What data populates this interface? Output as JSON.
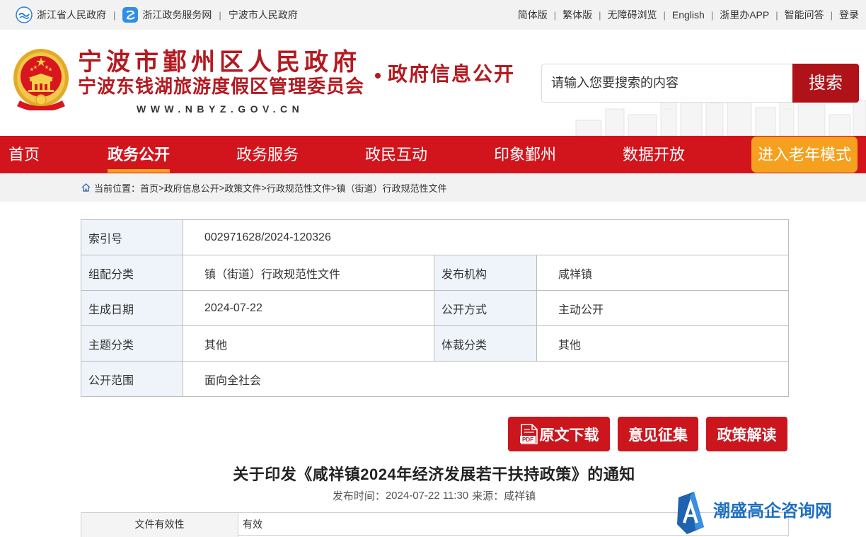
{
  "topbar": {
    "separator": "|",
    "left_links": [
      {
        "label": "浙江省人民政府",
        "icon": "zhejiang-province-gov-icon"
      },
      {
        "label": "浙江政务服务网",
        "icon": "zhejiang-gov-service-icon"
      },
      {
        "label": "宁波市人民政府"
      }
    ],
    "right_links": [
      "简体版",
      "繁体版",
      "无障碍浏览",
      "English",
      "浙里办APP",
      "智能问答",
      "登录"
    ]
  },
  "header": {
    "emblem_icon": "national-emblem-icon",
    "title_line1": "宁波市鄞州区人民政府",
    "title_line2": "宁波东钱湖旅游度假区管理委员会",
    "site_url": "WWW.NBYZ.GOV.CN",
    "section_title": "政府信息公开",
    "search": {
      "placeholder": "请输入您要搜索的内容",
      "button_label": "搜索"
    }
  },
  "nav": {
    "items": [
      "首页",
      "政务公开",
      "政务服务",
      "政民互动",
      "印象鄞州",
      "数据开放"
    ],
    "active_index": 1,
    "elder_mode_label": "进入老年模式"
  },
  "breadcrumb": {
    "home_icon": "home-icon",
    "prefix": "当前位置：",
    "separator": ">",
    "items": [
      "首页",
      "政府信息公开",
      "政策文件",
      "行政规范性文件",
      "镇（街道）行政规范性文件"
    ]
  },
  "meta_table": {
    "rows": [
      [
        {
          "label": "索引号",
          "value": "002971628/2024-120326"
        }
      ],
      [
        {
          "label": "组配分类",
          "value": "镇（街道）行政规范性文件"
        },
        {
          "label": "发布机构",
          "value": "咸祥镇"
        }
      ],
      [
        {
          "label": "生成日期",
          "value": "2024-07-22"
        },
        {
          "label": "公开方式",
          "value": "主动公开"
        }
      ],
      [
        {
          "label": "主题分类",
          "value": "其他"
        },
        {
          "label": "体裁分类",
          "value": "其他"
        }
      ],
      [
        {
          "label": "公开范围",
          "value": "面向全社会"
        }
      ]
    ]
  },
  "actions": {
    "download_icon": "pdf-icon",
    "pdf_icon_text": "PDF",
    "download_label": "原文下载",
    "comments_label": "意见征集",
    "interpretation_label": "政策解读"
  },
  "article": {
    "title": "关于印发《咸祥镇2024年经济发展若干扶持政策》的通知",
    "publish_time_label": "发布时间：",
    "publish_time": "2024-07-22 11:30",
    "source_label": "来源：",
    "source": "咸祥镇"
  },
  "validity_table": {
    "rows": [
      {
        "label": "文件有效性",
        "value": "有效"
      }
    ]
  },
  "watermark": {
    "logo_icon": "watermark-a-logo-icon",
    "text": "潮盛高企咨询网"
  },
  "colors": {
    "topbar_bg": "#f2f2f2",
    "brand_red": "#d2141c",
    "title_red": "#b31a20",
    "search_button": "#b0121a",
    "active_underline": "#f6a11d",
    "elder_mode_bg": "#f5a01e",
    "label_cell_bg": "#eef4fa",
    "action_button": "#cb161e",
    "watermark_blue": "#1f6fc2"
  }
}
